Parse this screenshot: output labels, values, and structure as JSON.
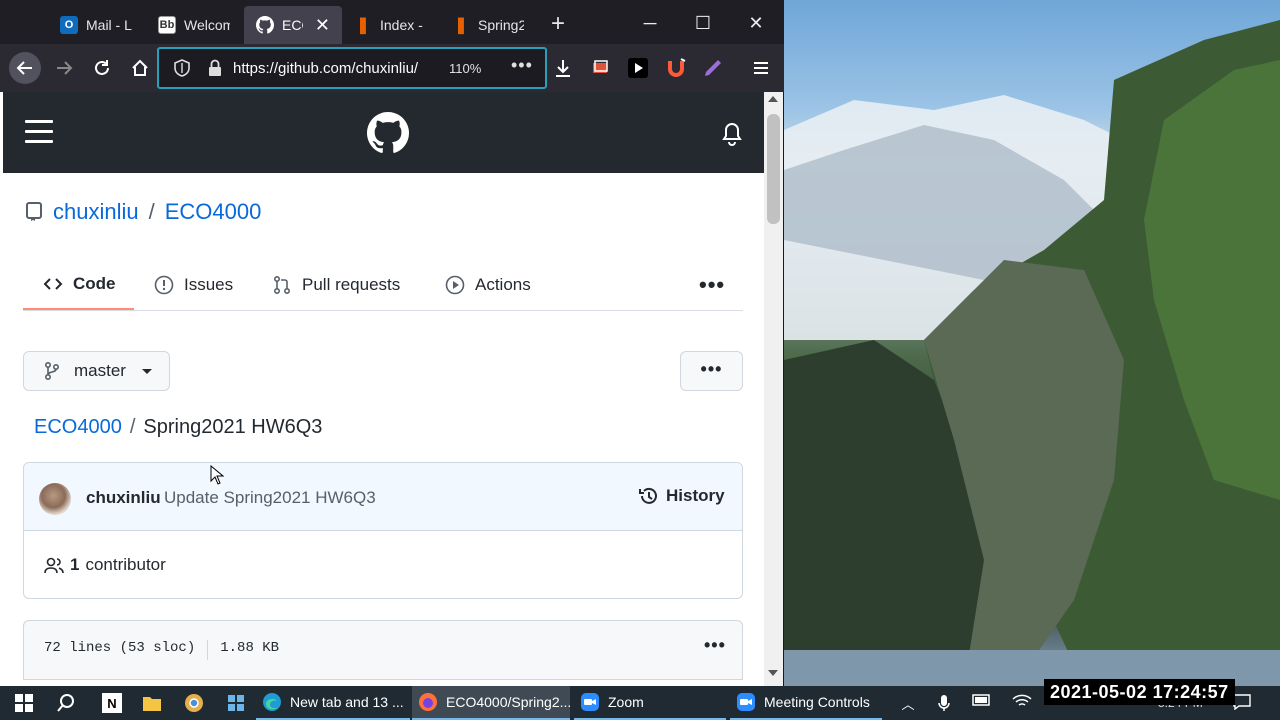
{
  "browser": {
    "tabs": [
      {
        "title": "Mail - L",
        "favicon": "outlook-icon",
        "favicon_color": "#0f6cbd"
      },
      {
        "title": "Welcom",
        "favicon": "blackboard-icon",
        "favicon_color": "#333333"
      },
      {
        "title": "ECO",
        "favicon": "github-icon",
        "favicon_color": "#ffffff",
        "active": true
      },
      {
        "title": "Index -",
        "favicon": "book-icon",
        "favicon_color": "#e66000"
      },
      {
        "title": "Spring2",
        "favicon": "book-icon",
        "favicon_color": "#e66000"
      }
    ],
    "url": "https://github.com/chuxinliu/",
    "zoom": "110%"
  },
  "repo": {
    "owner": "chuxinliu",
    "separator": "/",
    "name": "ECO4000"
  },
  "nav_tabs": [
    {
      "label": "Code",
      "icon": "code-icon",
      "selected": true
    },
    {
      "label": "Issues",
      "icon": "issue-icon"
    },
    {
      "label": "Pull requests",
      "icon": "pull-request-icon"
    },
    {
      "label": "Actions",
      "icon": "play-icon"
    }
  ],
  "branch": {
    "label": "master"
  },
  "breadcrumb": {
    "repo": "ECO4000",
    "separator": "/",
    "file": "Spring2021 HW6Q3"
  },
  "commit": {
    "author": "chuxinliu",
    "message": "Update Spring2021 HW6Q3",
    "history_label": "History"
  },
  "contributors": {
    "count": "1",
    "label": "contributor"
  },
  "file_info": {
    "lines": "72 lines (53 sloc)",
    "size": "1.88 KB"
  },
  "taskbar": {
    "items": [
      {
        "label": "New tab and 13 ...",
        "icon": "edge-icon"
      },
      {
        "label": "ECO4000/Spring2...",
        "icon": "firefox-icon"
      },
      {
        "label": "Zoom",
        "icon": "zoom-icon"
      },
      {
        "label": "Meeting Controls",
        "icon": "zoom-icon"
      }
    ],
    "overlay_timestamp": "2021-05-02  17:24:57",
    "clock_time": "5:24 PM"
  },
  "colors": {
    "accent_blue": "#0969da",
    "header_dark": "#24292f",
    "tab_underline": "#fd8c73"
  }
}
